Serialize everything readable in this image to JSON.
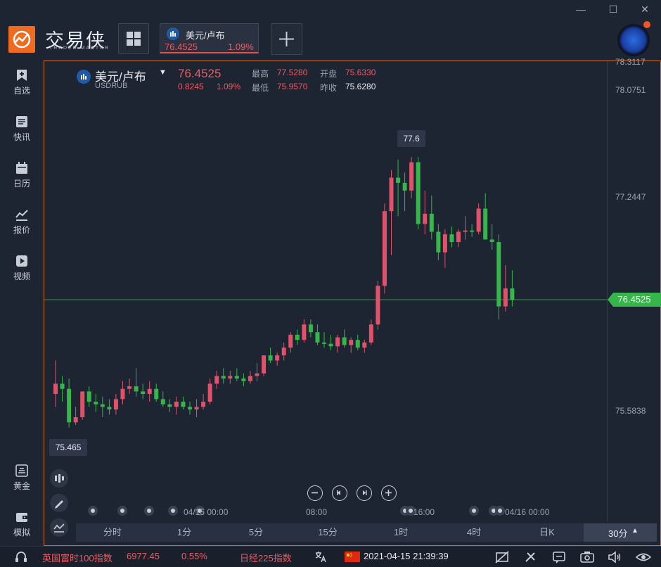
{
  "window": {
    "minimize": "—",
    "maximize": "☐",
    "close": "✕"
  },
  "brand": {
    "name": "交易侠",
    "sub": "TRADER MASTER"
  },
  "tab": {
    "name": "美元/卢布",
    "price": "76.4525",
    "change_pct": "1.09%"
  },
  "sidebar": {
    "items": [
      {
        "label": "自选",
        "icon": "bookmark-icon"
      },
      {
        "label": "快讯",
        "icon": "news-icon"
      },
      {
        "label": "日历",
        "icon": "calendar-icon"
      },
      {
        "label": "报价",
        "icon": "quote-icon"
      },
      {
        "label": "视频",
        "icon": "video-icon"
      },
      {
        "label": "黄金",
        "icon": "gold-icon"
      },
      {
        "label": "模拟",
        "icon": "wallet-icon"
      }
    ]
  },
  "quote": {
    "symbol_name": "美元/卢布",
    "symbol_code": "USDRUB",
    "price": "76.4525",
    "change": "0.8245",
    "change_pct": "1.09%",
    "high_label": "最高",
    "high": "77.5280",
    "low_label": "最低",
    "low": "75.9570",
    "open_label": "开盘",
    "open": "75.6330",
    "prev_label": "昨收",
    "prev_close": "75.6280"
  },
  "chart_data": {
    "type": "candlestick",
    "y_ticks": [
      "78.3117",
      "78.0751",
      "77.2447",
      "75.5838"
    ],
    "current_price_label": "76.4525",
    "x_ticks": [
      "04/15 00:00",
      "08:00",
      "16:00",
      "04/16 00:00"
    ],
    "max_marker": "77.6",
    "min_marker": "75.465",
    "colors": {
      "up": "#e0516a",
      "down": "#35b54a",
      "current_line": "#3fbf5a"
    },
    "candles": [
      {
        "o": 75.72,
        "h": 75.98,
        "l": 75.62,
        "c": 75.8
      },
      {
        "o": 75.8,
        "h": 75.86,
        "l": 75.66,
        "c": 75.76
      },
      {
        "o": 75.76,
        "h": 75.84,
        "l": 75.46,
        "c": 75.5
      },
      {
        "o": 75.5,
        "h": 75.62,
        "l": 75.48,
        "c": 75.54
      },
      {
        "o": 75.54,
        "h": 75.7,
        "l": 75.52,
        "c": 75.74
      },
      {
        "o": 75.74,
        "h": 75.78,
        "l": 75.62,
        "c": 75.66
      },
      {
        "o": 75.66,
        "h": 75.72,
        "l": 75.58,
        "c": 75.64
      },
      {
        "o": 75.64,
        "h": 75.7,
        "l": 75.54,
        "c": 75.62
      },
      {
        "o": 75.62,
        "h": 75.68,
        "l": 75.56,
        "c": 75.6
      },
      {
        "o": 75.6,
        "h": 75.72,
        "l": 75.56,
        "c": 75.68
      },
      {
        "o": 75.68,
        "h": 75.82,
        "l": 75.64,
        "c": 75.76
      },
      {
        "o": 75.76,
        "h": 75.84,
        "l": 75.72,
        "c": 75.78
      },
      {
        "o": 75.78,
        "h": 75.92,
        "l": 75.7,
        "c": 75.74
      },
      {
        "o": 75.74,
        "h": 75.8,
        "l": 75.68,
        "c": 75.72
      },
      {
        "o": 75.72,
        "h": 75.82,
        "l": 75.66,
        "c": 75.76
      },
      {
        "o": 75.76,
        "h": 75.8,
        "l": 75.66,
        "c": 75.68
      },
      {
        "o": 75.68,
        "h": 75.74,
        "l": 75.62,
        "c": 75.64
      },
      {
        "o": 75.64,
        "h": 75.68,
        "l": 75.58,
        "c": 75.62
      },
      {
        "o": 75.62,
        "h": 75.7,
        "l": 75.56,
        "c": 75.66
      },
      {
        "o": 75.66,
        "h": 75.7,
        "l": 75.6,
        "c": 75.62
      },
      {
        "o": 75.62,
        "h": 75.66,
        "l": 75.56,
        "c": 75.6
      },
      {
        "o": 75.6,
        "h": 75.68,
        "l": 75.54,
        "c": 75.62
      },
      {
        "o": 75.62,
        "h": 75.72,
        "l": 75.6,
        "c": 75.66
      },
      {
        "o": 75.66,
        "h": 75.84,
        "l": 75.64,
        "c": 75.8
      },
      {
        "o": 75.8,
        "h": 75.9,
        "l": 75.76,
        "c": 75.86
      },
      {
        "o": 75.86,
        "h": 75.92,
        "l": 75.8,
        "c": 75.84
      },
      {
        "o": 75.84,
        "h": 75.9,
        "l": 75.8,
        "c": 75.86
      },
      {
        "o": 75.86,
        "h": 75.92,
        "l": 75.82,
        "c": 75.84
      },
      {
        "o": 75.84,
        "h": 75.88,
        "l": 75.78,
        "c": 75.82
      },
      {
        "o": 75.82,
        "h": 75.9,
        "l": 75.8,
        "c": 75.86
      },
      {
        "o": 75.86,
        "h": 75.96,
        "l": 75.82,
        "c": 75.88
      },
      {
        "o": 75.88,
        "h": 76.0,
        "l": 75.86,
        "c": 76.02
      },
      {
        "o": 76.02,
        "h": 76.08,
        "l": 75.96,
        "c": 75.98
      },
      {
        "o": 75.98,
        "h": 76.04,
        "l": 75.94,
        "c": 76.02
      },
      {
        "o": 76.02,
        "h": 76.12,
        "l": 75.98,
        "c": 76.08
      },
      {
        "o": 76.08,
        "h": 76.2,
        "l": 76.04,
        "c": 76.18
      },
      {
        "o": 76.18,
        "h": 76.22,
        "l": 76.1,
        "c": 76.14
      },
      {
        "o": 76.14,
        "h": 76.3,
        "l": 76.12,
        "c": 76.26
      },
      {
        "o": 76.26,
        "h": 76.3,
        "l": 76.16,
        "c": 76.2
      },
      {
        "o": 76.2,
        "h": 76.26,
        "l": 76.1,
        "c": 76.12
      },
      {
        "o": 76.12,
        "h": 76.2,
        "l": 76.08,
        "c": 76.11
      },
      {
        "o": 76.11,
        "h": 76.18,
        "l": 76.06,
        "c": 76.09
      },
      {
        "o": 76.09,
        "h": 76.18,
        "l": 76.04,
        "c": 76.16
      },
      {
        "o": 76.16,
        "h": 76.22,
        "l": 76.08,
        "c": 76.1
      },
      {
        "o": 76.1,
        "h": 76.16,
        "l": 76.04,
        "c": 76.14
      },
      {
        "o": 76.14,
        "h": 76.18,
        "l": 76.06,
        "c": 76.08
      },
      {
        "o": 76.08,
        "h": 76.14,
        "l": 76.04,
        "c": 76.12
      },
      {
        "o": 76.12,
        "h": 76.3,
        "l": 76.1,
        "c": 76.26
      },
      {
        "o": 76.26,
        "h": 76.6,
        "l": 76.22,
        "c": 76.56
      },
      {
        "o": 76.56,
        "h": 77.2,
        "l": 76.5,
        "c": 77.14
      },
      {
        "o": 77.14,
        "h": 77.46,
        "l": 76.8,
        "c": 77.4
      },
      {
        "o": 77.4,
        "h": 77.54,
        "l": 77.1,
        "c": 77.36
      },
      {
        "o": 77.36,
        "h": 77.44,
        "l": 77.14,
        "c": 77.3
      },
      {
        "o": 77.3,
        "h": 77.56,
        "l": 77.24,
        "c": 77.52
      },
      {
        "o": 77.52,
        "h": 77.56,
        "l": 77.0,
        "c": 77.04
      },
      {
        "o": 77.04,
        "h": 77.3,
        "l": 76.96,
        "c": 77.12
      },
      {
        "o": 77.12,
        "h": 77.26,
        "l": 76.92,
        "c": 76.98
      },
      {
        "o": 76.98,
        "h": 77.04,
        "l": 76.76,
        "c": 76.82
      },
      {
        "o": 76.82,
        "h": 77.0,
        "l": 76.7,
        "c": 76.96
      },
      {
        "o": 76.96,
        "h": 77.02,
        "l": 76.86,
        "c": 76.9
      },
      {
        "o": 76.9,
        "h": 77.0,
        "l": 76.86,
        "c": 76.98
      },
      {
        "o": 76.98,
        "h": 77.1,
        "l": 76.92,
        "c": 76.99
      },
      {
        "o": 76.99,
        "h": 77.04,
        "l": 76.94,
        "c": 76.98
      },
      {
        "o": 76.98,
        "h": 77.2,
        "l": 76.96,
        "c": 77.16
      },
      {
        "o": 77.16,
        "h": 77.28,
        "l": 76.96,
        "c": 76.92
      },
      {
        "o": 76.92,
        "h": 77.04,
        "l": 76.84,
        "c": 76.9
      },
      {
        "o": 76.9,
        "h": 76.96,
        "l": 76.3,
        "c": 76.4
      },
      {
        "o": 76.4,
        "h": 76.72,
        "l": 76.36,
        "c": 76.54
      },
      {
        "o": 76.54,
        "h": 76.68,
        "l": 76.4,
        "c": 76.45
      }
    ]
  },
  "chart_controls": [
    "zoom-out-icon",
    "prev-icon",
    "next-icon",
    "zoom-in-icon"
  ],
  "periods": {
    "items": [
      "分时",
      "1分",
      "5分",
      "15分",
      "1时",
      "4时",
      "日K",
      "30分"
    ],
    "active": "30分"
  },
  "statusbar": {
    "index1_name": "英国富时100指数",
    "index1_value": "6977.45",
    "index1_pct": "0.55%",
    "index2_name": "日经225指数",
    "datetime": "2021-04-15 21:39:39"
  }
}
